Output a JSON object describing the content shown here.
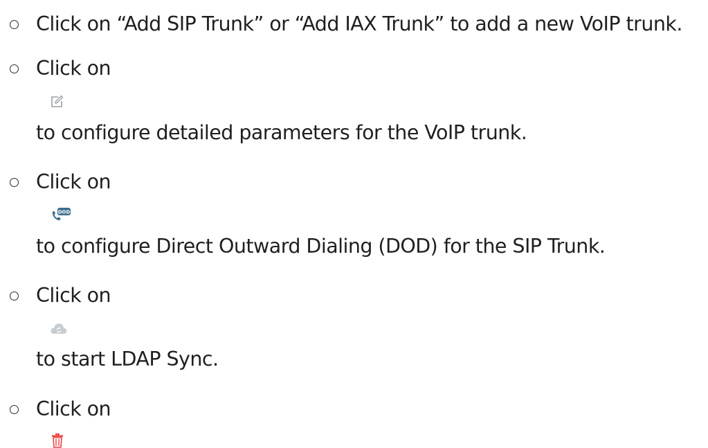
{
  "items": [
    {
      "text": "Click on “Add SIP Trunk” or “Add IAX Trunk” to add a new VoIP trunk."
    },
    {
      "prefix": "Click on",
      "icon": "edit-icon",
      "suffix": "to configure detailed parameters for the VoIP trunk."
    },
    {
      "prefix": "Click on",
      "icon": "dod-phone-icon",
      "suffix": "to configure Direct Outward Dialing (DOD) for the SIP Trunk.",
      "icon_label": "DOD"
    },
    {
      "prefix": "Click on",
      "icon": "cloud-sync-icon",
      "suffix": "to start LDAP Sync."
    },
    {
      "prefix": "Click on",
      "icon": "trash-icon"
    }
  ],
  "colors": {
    "text": "#1f1f1f",
    "edit_icon": "#9aa0a6",
    "dod_icon": "#3d6e8f",
    "cloud_icon": "#c8cdd1",
    "trash_icon": "#e84040"
  }
}
